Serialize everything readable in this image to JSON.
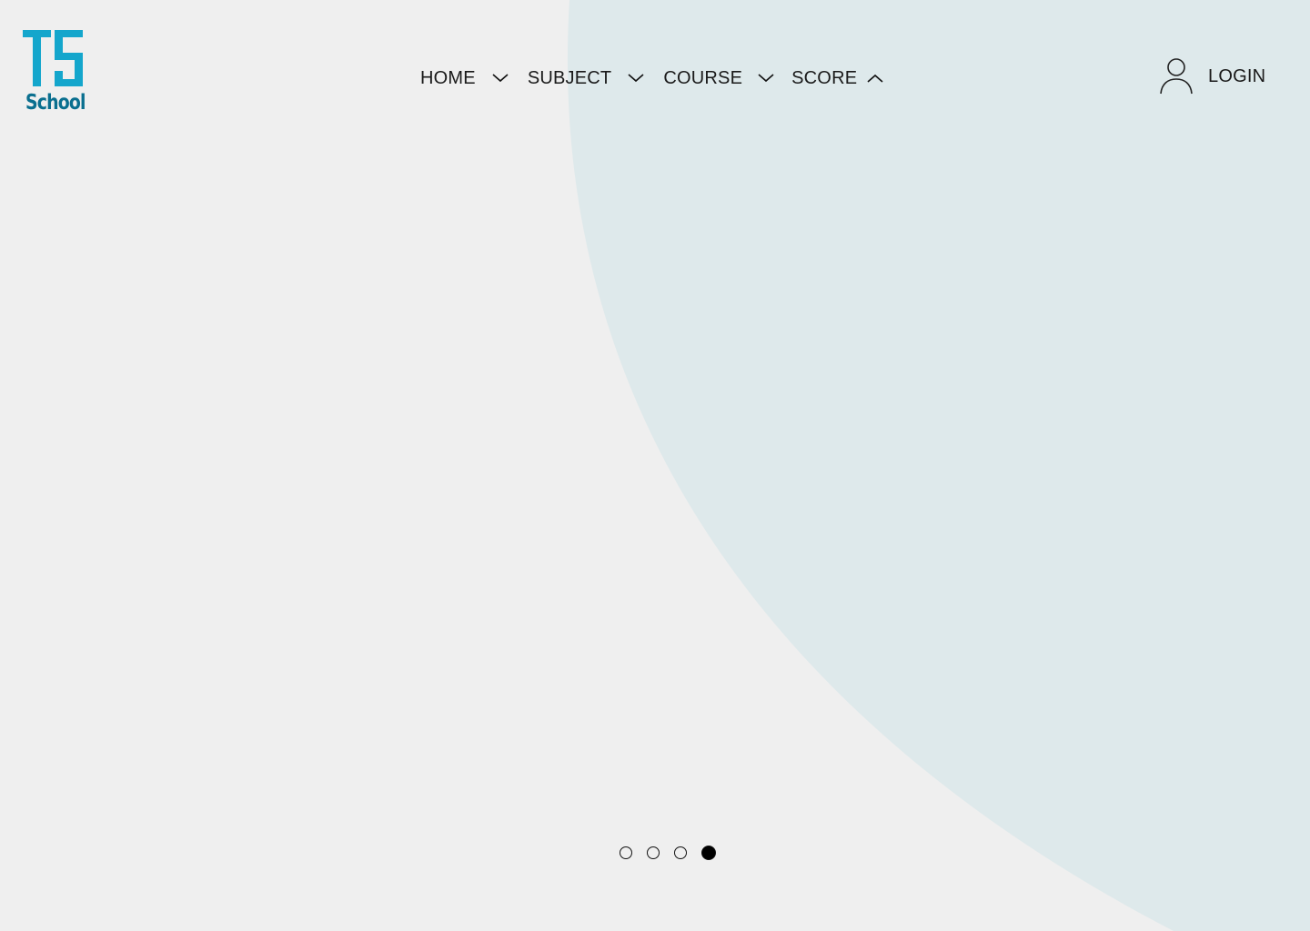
{
  "brand": {
    "mark": "T5",
    "name": "School",
    "primary_color": "#14a6cc",
    "secondary_color": "#0a6f8f"
  },
  "nav": {
    "items": [
      {
        "label": "HOME",
        "chevron": "chevron-down-icon"
      },
      {
        "label": "SUBJECT",
        "chevron": "chevron-down-icon"
      },
      {
        "label": "COURSE",
        "chevron": "chevron-down-icon"
      },
      {
        "label": "SCORE",
        "chevron": "chevron-up-icon"
      }
    ]
  },
  "login": {
    "label": "LOGIN",
    "icon": "user-icon"
  },
  "carousel": {
    "slide_count": 4,
    "active_index": 3
  },
  "colors": {
    "page_background": "#efefef",
    "accent_shape": "#dee9eb",
    "text": "#1a1a1a"
  }
}
